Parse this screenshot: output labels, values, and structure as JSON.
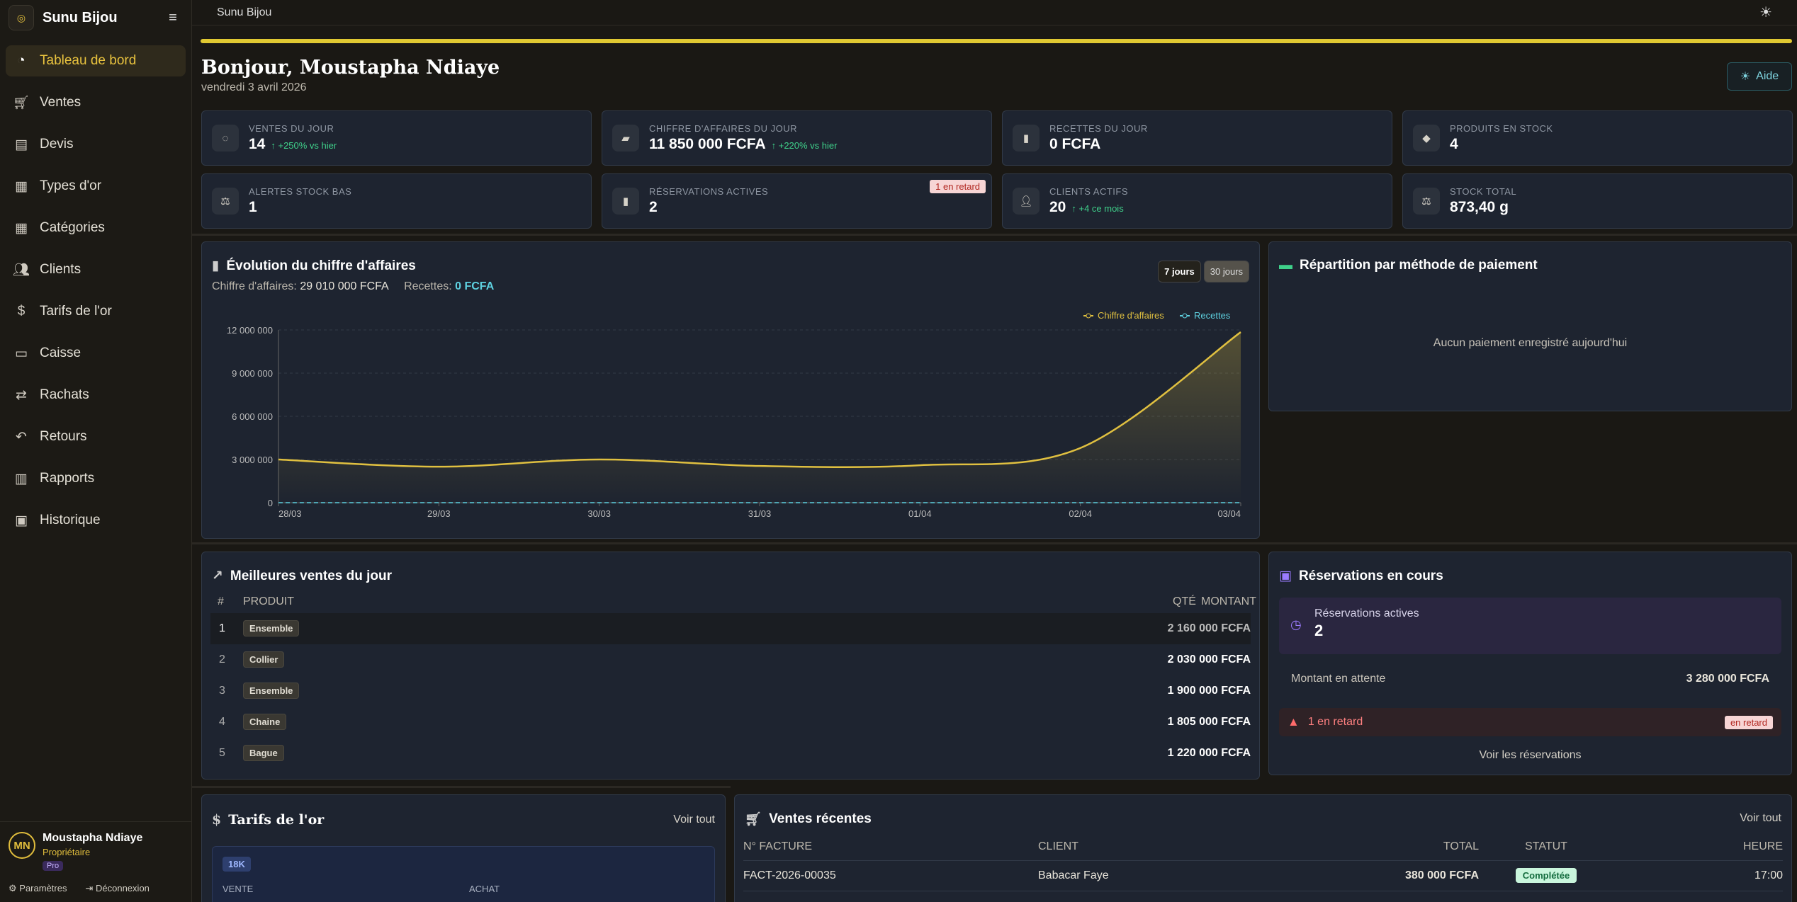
{
  "app": {
    "name": "Sunu Bijou",
    "breadcrumb": "Sunu Bijou"
  },
  "nav": [
    {
      "label": "Tableau de bord",
      "icon": "pie-chart-icon",
      "active": true
    },
    {
      "label": "Ventes",
      "icon": "cart-icon"
    },
    {
      "label": "Devis",
      "icon": "document-icon"
    },
    {
      "label": "Types d'or",
      "icon": "grid-icon"
    },
    {
      "label": "Catégories",
      "icon": "grid-icon"
    },
    {
      "label": "Clients",
      "icon": "users-icon"
    },
    {
      "label": "Tarifs de l'or",
      "icon": "coin-icon"
    },
    {
      "label": "Caisse",
      "icon": "cash-register-icon"
    },
    {
      "label": "Rachats",
      "icon": "swap-icon"
    },
    {
      "label": "Retours",
      "icon": "undo-icon"
    },
    {
      "label": "Rapports",
      "icon": "report-icon"
    },
    {
      "label": "Historique",
      "icon": "clipboard-icon"
    }
  ],
  "user": {
    "initials": "MN",
    "name": "Moustapha Ndiaye",
    "role": "Propriétaire",
    "plan": "Pro",
    "settings": "Paramètres",
    "logout": "Déconnexion"
  },
  "header": {
    "greeting": "Bonjour, Moustapha Ndiaye",
    "date": "vendredi 3 avril 2026",
    "help": "Aide"
  },
  "stats": [
    {
      "label": "Ventes du jour",
      "value": "14",
      "delta": "↑ +250% vs hier",
      "icon": "bag-icon"
    },
    {
      "label": "Chiffre d'affaires du jour",
      "value": "11 850 000 FCFA",
      "delta": "↑ +220% vs hier",
      "icon": "money-icon"
    },
    {
      "label": "Recettes du jour",
      "value": "0 FCFA",
      "delta": "",
      "icon": "wallet-icon"
    },
    {
      "label": "Produits en stock",
      "value": "4",
      "delta": "",
      "icon": "gem-icon"
    },
    {
      "label": "Alertes stock bas",
      "value": "1",
      "delta": "",
      "icon": "scale-icon"
    },
    {
      "label": "Réservations actives",
      "value": "2",
      "delta": "",
      "icon": "bookmark-icon",
      "badge": "1 en retard"
    },
    {
      "label": "Clients actifs",
      "value": "20",
      "delta": "↑ +4 ce mois",
      "icon": "user-icon"
    },
    {
      "label": "Stock total",
      "value": "873,40 g",
      "delta": "",
      "icon": "balance-icon"
    }
  ],
  "revenue": {
    "title": "Évolution du chiffre d'affaires",
    "ca_label": "Chiffre d'affaires:",
    "ca_value": "29 010 000 FCFA",
    "rec_label": "Recettes:",
    "rec_value": "0 FCFA",
    "range_7": "7 jours",
    "range_30": "30 jours"
  },
  "chart_data": {
    "type": "line",
    "categories": [
      "28/03",
      "29/03",
      "30/03",
      "31/03",
      "01/04",
      "02/04",
      "03/04"
    ],
    "series": [
      {
        "name": "Chiffre d'affaires",
        "values": [
          3000000,
          2500000,
          3000000,
          2550000,
          2600000,
          3800000,
          11850000
        ],
        "color": "#e0c040"
      },
      {
        "name": "Recettes",
        "values": [
          0,
          0,
          0,
          0,
          0,
          0,
          0
        ],
        "color": "#5ed1e0"
      }
    ],
    "yticks": [
      "0",
      "3 000 000",
      "6 000 000",
      "9 000 000",
      "12 000 000"
    ],
    "ylim": [
      0,
      12000000
    ]
  },
  "payments": {
    "title": "Répartition par méthode de paiement",
    "empty": "Aucun paiement enregistré aujourd'hui"
  },
  "best": {
    "title": "Meilleures ventes du jour",
    "cols": [
      "#",
      "Produit",
      "Qté",
      "Montant"
    ],
    "rows": [
      {
        "rank": "1",
        "product": "Ensemble",
        "amount": "2 160 000 FCFA"
      },
      {
        "rank": "2",
        "product": "Collier",
        "amount": "2 030 000 FCFA"
      },
      {
        "rank": "3",
        "product": "Ensemble",
        "amount": "1 900 000 FCFA"
      },
      {
        "rank": "4",
        "product": "Chaine",
        "amount": "1 805 000 FCFA"
      },
      {
        "rank": "5",
        "product": "Bague",
        "amount": "1 220 000 FCFA"
      }
    ]
  },
  "reservations": {
    "title": "Réservations en cours",
    "active_label": "Réservations actives",
    "active_value": "2",
    "pending_label": "Montant en attente",
    "pending_value": "3 280 000 FCFA",
    "late_label": "1 en retard",
    "late_badge": "en retard",
    "link": "Voir les réservations"
  },
  "rates": {
    "title": "Tarifs de l'or",
    "link": "Voir tout",
    "karat": "18K",
    "sell": "Vente",
    "buy": "Achat"
  },
  "recent": {
    "title": "Ventes récentes",
    "link": "Voir tout",
    "cols": [
      "N° Facture",
      "Client",
      "Total",
      "Statut",
      "Heure"
    ],
    "rows": [
      {
        "invoice": "FACT-2026-00035",
        "client": "Babacar Faye",
        "total": "380 000 FCFA",
        "status": "Complétée",
        "time": "17:00"
      }
    ]
  }
}
